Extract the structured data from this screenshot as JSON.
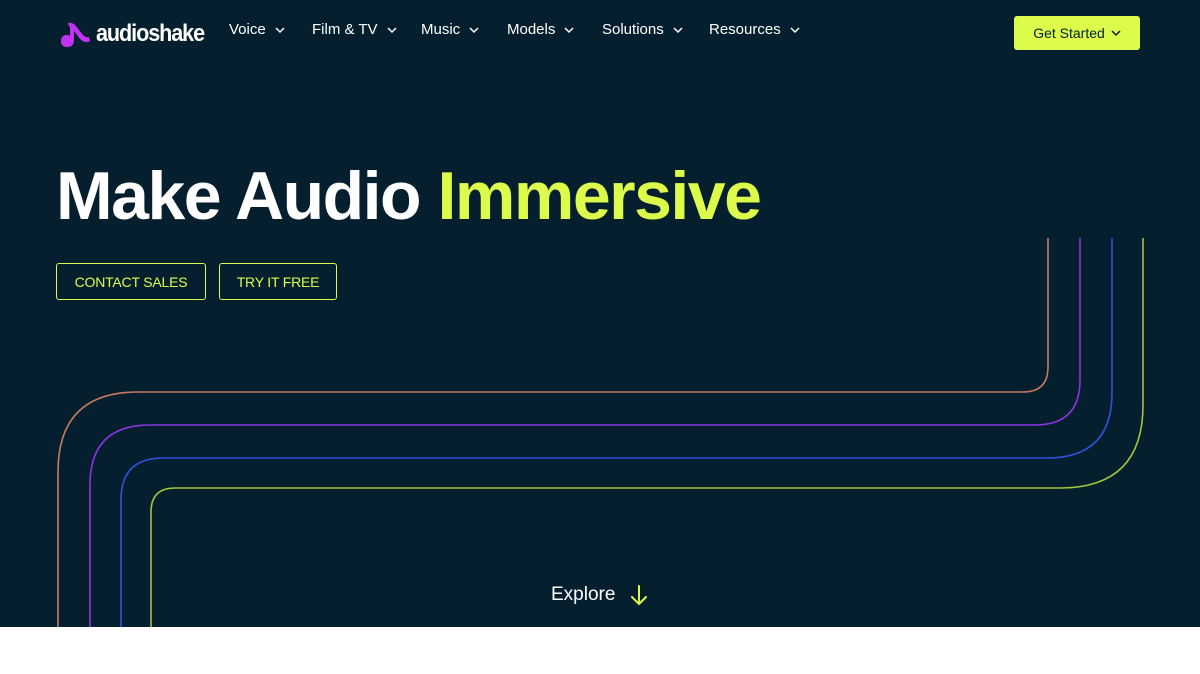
{
  "brand": {
    "name": "audioshake",
    "logo_icon": "music-note-icon",
    "accent": "#ddfb4b",
    "logo_color": "#c133f3",
    "background": "#051f2e"
  },
  "nav": {
    "items": [
      {
        "label": "Voice"
      },
      {
        "label": "Film & TV"
      },
      {
        "label": "Music"
      },
      {
        "label": "Models"
      },
      {
        "label": "Solutions"
      },
      {
        "label": "Resources"
      }
    ],
    "cta_label": "Get Started"
  },
  "hero": {
    "headline_white": "Make Audio",
    "headline_accent": "Immersive",
    "contact_label": "CONTACT SALES",
    "try_label": "TRY IT FREE",
    "explore_label": "Explore",
    "line_colors": [
      "#c77a62",
      "#8a34e0",
      "#2f52e0",
      "#9ec43a"
    ]
  }
}
